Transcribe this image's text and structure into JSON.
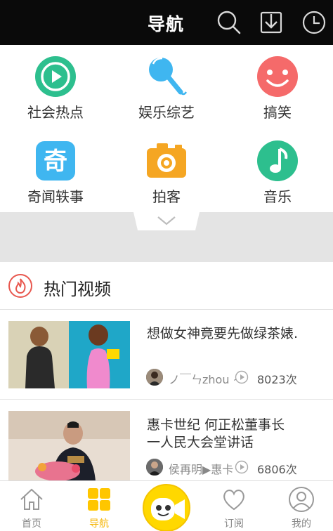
{
  "header": {
    "title": "导航",
    "icons": [
      "search-icon",
      "download-icon",
      "history-clock-icon"
    ]
  },
  "categories": [
    {
      "label": "社会热点",
      "icon": "play-icon",
      "color": "#2dbf8e"
    },
    {
      "label": "娱乐综艺",
      "icon": "microphone-icon",
      "color": "#3fb6f0"
    },
    {
      "label": "搞笑",
      "icon": "smile-icon",
      "color": "#f56a6a"
    },
    {
      "label": "奇闻轶事",
      "icon": "qi-character-icon",
      "color": "#3fb6f0",
      "glyph": "奇"
    },
    {
      "label": "拍客",
      "icon": "camera-icon",
      "color": "#f5a623"
    },
    {
      "label": "音乐",
      "icon": "music-note-icon",
      "color": "#2dbf8e"
    }
  ],
  "hot": {
    "title": "热门视频",
    "videos": [
      {
        "title": "想做女神竟要先做绿茶婊.",
        "author": "ノ￣ㄣzhou ~",
        "views": "8023次"
      },
      {
        "title": "惠卡世纪 何正松董事长一人民大会堂讲话",
        "author": "侯再明▶惠卡",
        "views": "6806次"
      }
    ]
  },
  "bottom_nav": {
    "items": [
      {
        "label": "首页",
        "icon": "home-icon"
      },
      {
        "label": "导航",
        "icon": "grid-icon",
        "active": true
      },
      {
        "label": "",
        "icon": "video-camera-face-icon"
      },
      {
        "label": "订阅",
        "icon": "heart-icon"
      },
      {
        "label": "我的",
        "icon": "user-icon"
      }
    ]
  },
  "colors": {
    "accent": "#ffd800",
    "active_tab": "#f5b400",
    "header_bg": "#0a0a0a"
  }
}
